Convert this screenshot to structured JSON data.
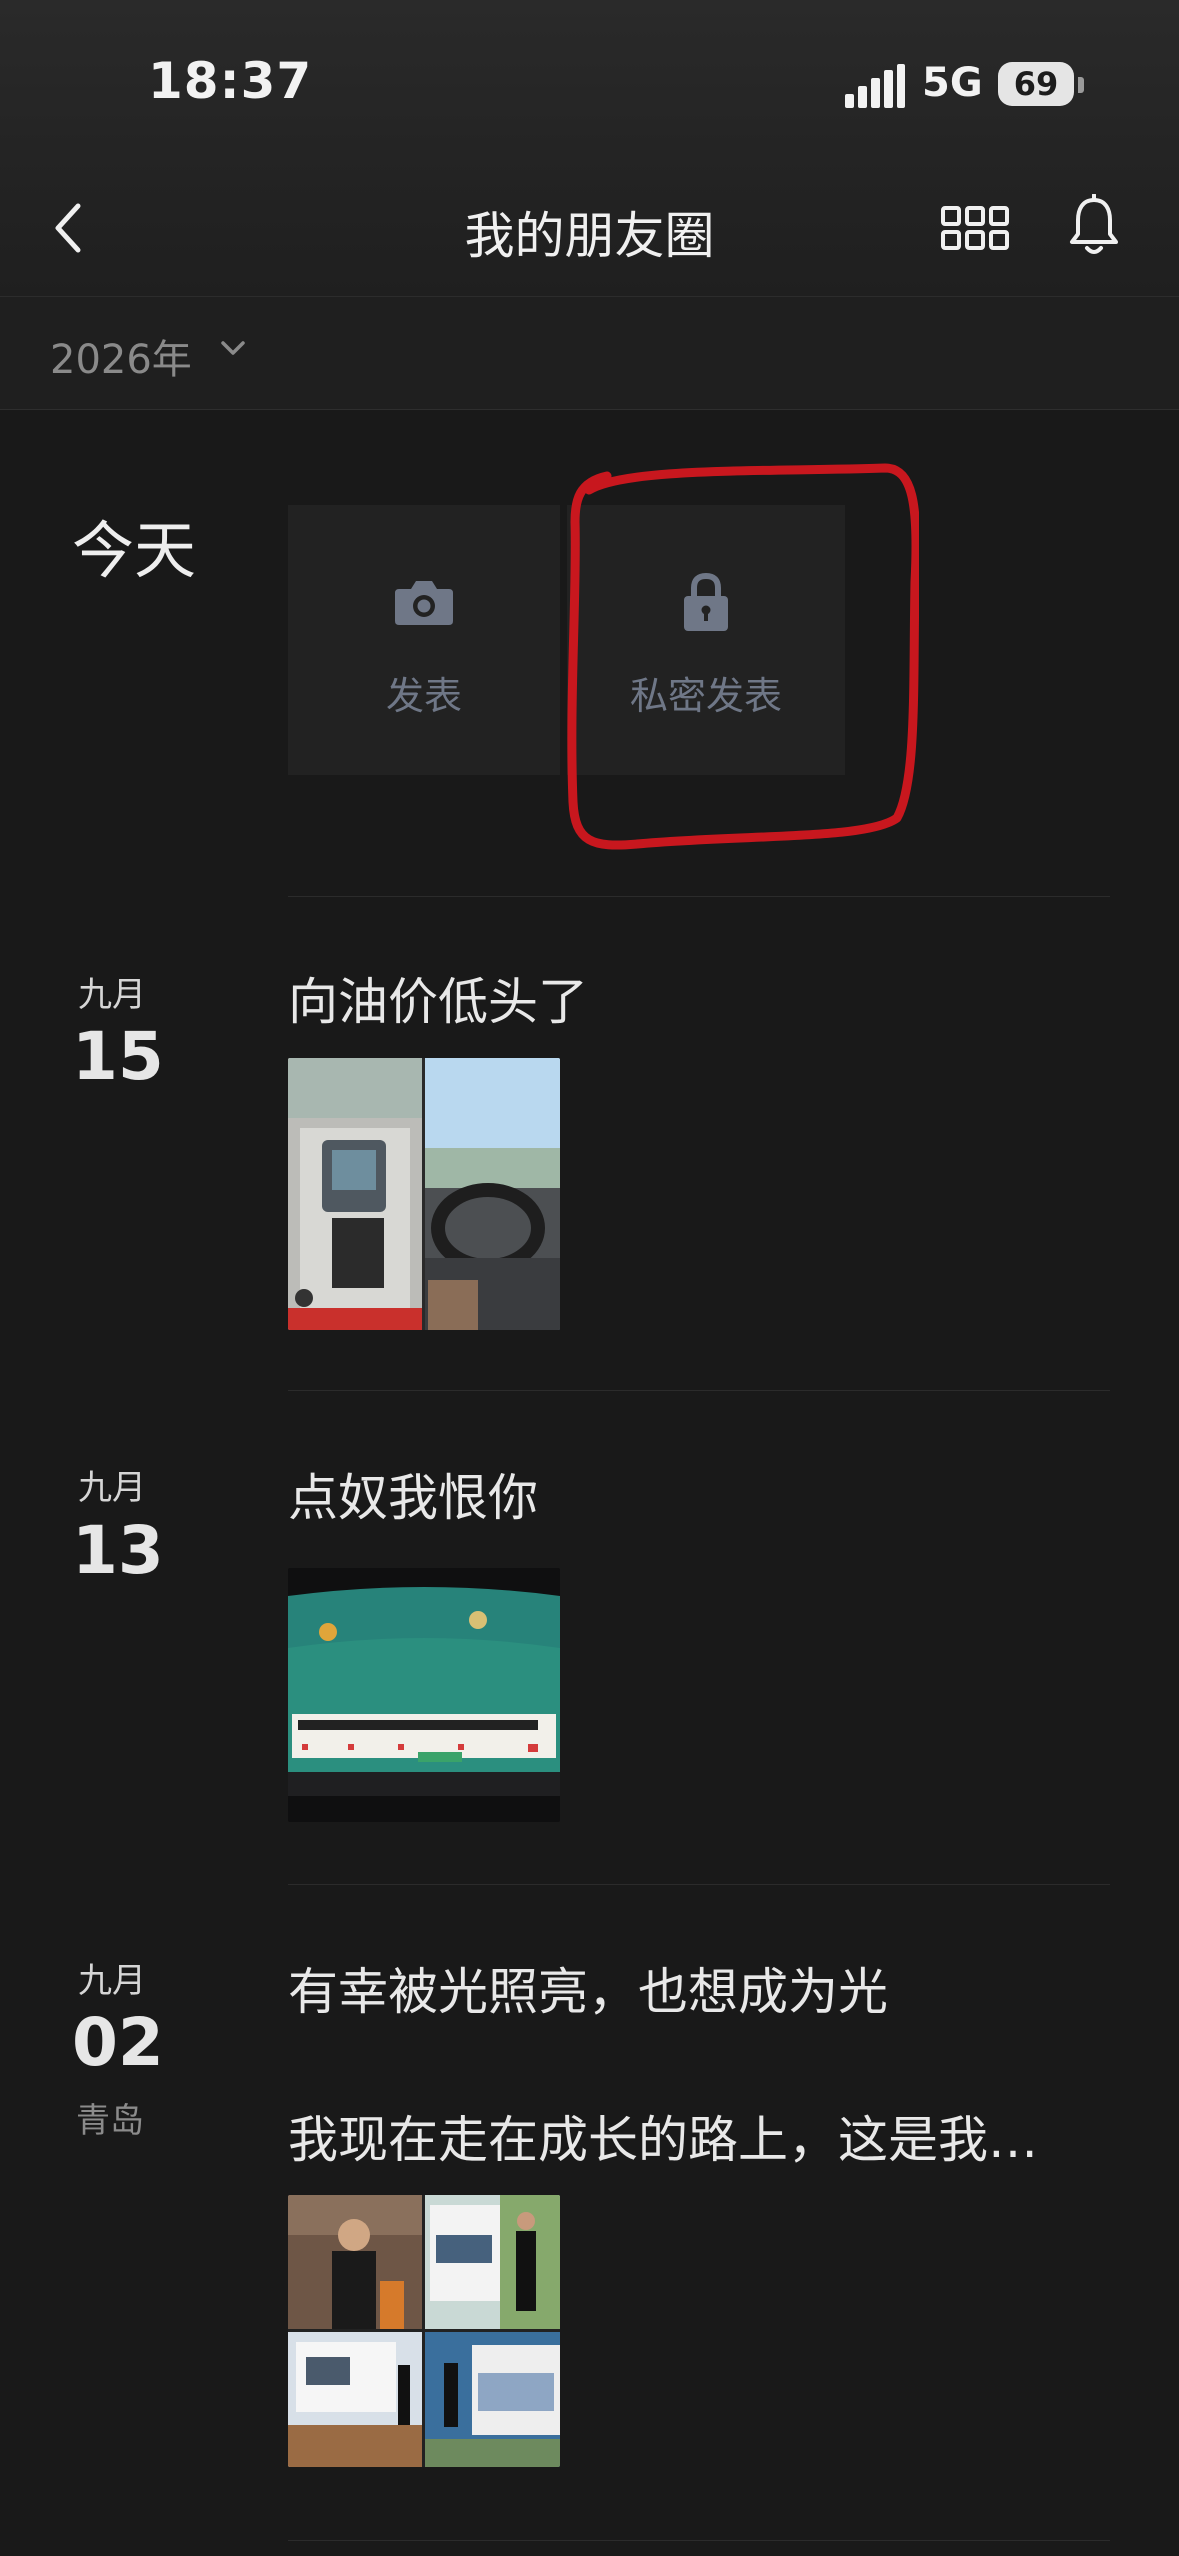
{
  "status_bar": {
    "time": "18:37",
    "network": "5G",
    "battery": "69"
  },
  "nav": {
    "title": "我的朋友圈",
    "back_icon": "back-chevron-icon",
    "grid_icon": "grid-icon",
    "bell_icon": "bell-icon"
  },
  "year_filter": {
    "label": "2026年"
  },
  "today": {
    "label": "今天",
    "publish_label": "发表",
    "private_publish_label": "私密发表"
  },
  "posts": [
    {
      "month": "九月",
      "day": "15",
      "location": "",
      "text": "向油价低头了",
      "text2": "",
      "image_count": 2
    },
    {
      "month": "九月",
      "day": "13",
      "location": "",
      "text": "点奴我恨你",
      "text2": "",
      "image_count": 1
    },
    {
      "month": "九月",
      "day": "02",
      "location": "青岛",
      "text": "有幸被光照亮，也想成为光",
      "text2": "我现在走在成长的路上，这是我…",
      "image_count": 4
    }
  ],
  "colors": {
    "background": "#191919",
    "annotation": "#c8171e",
    "tile_label": "#6f7787"
  }
}
